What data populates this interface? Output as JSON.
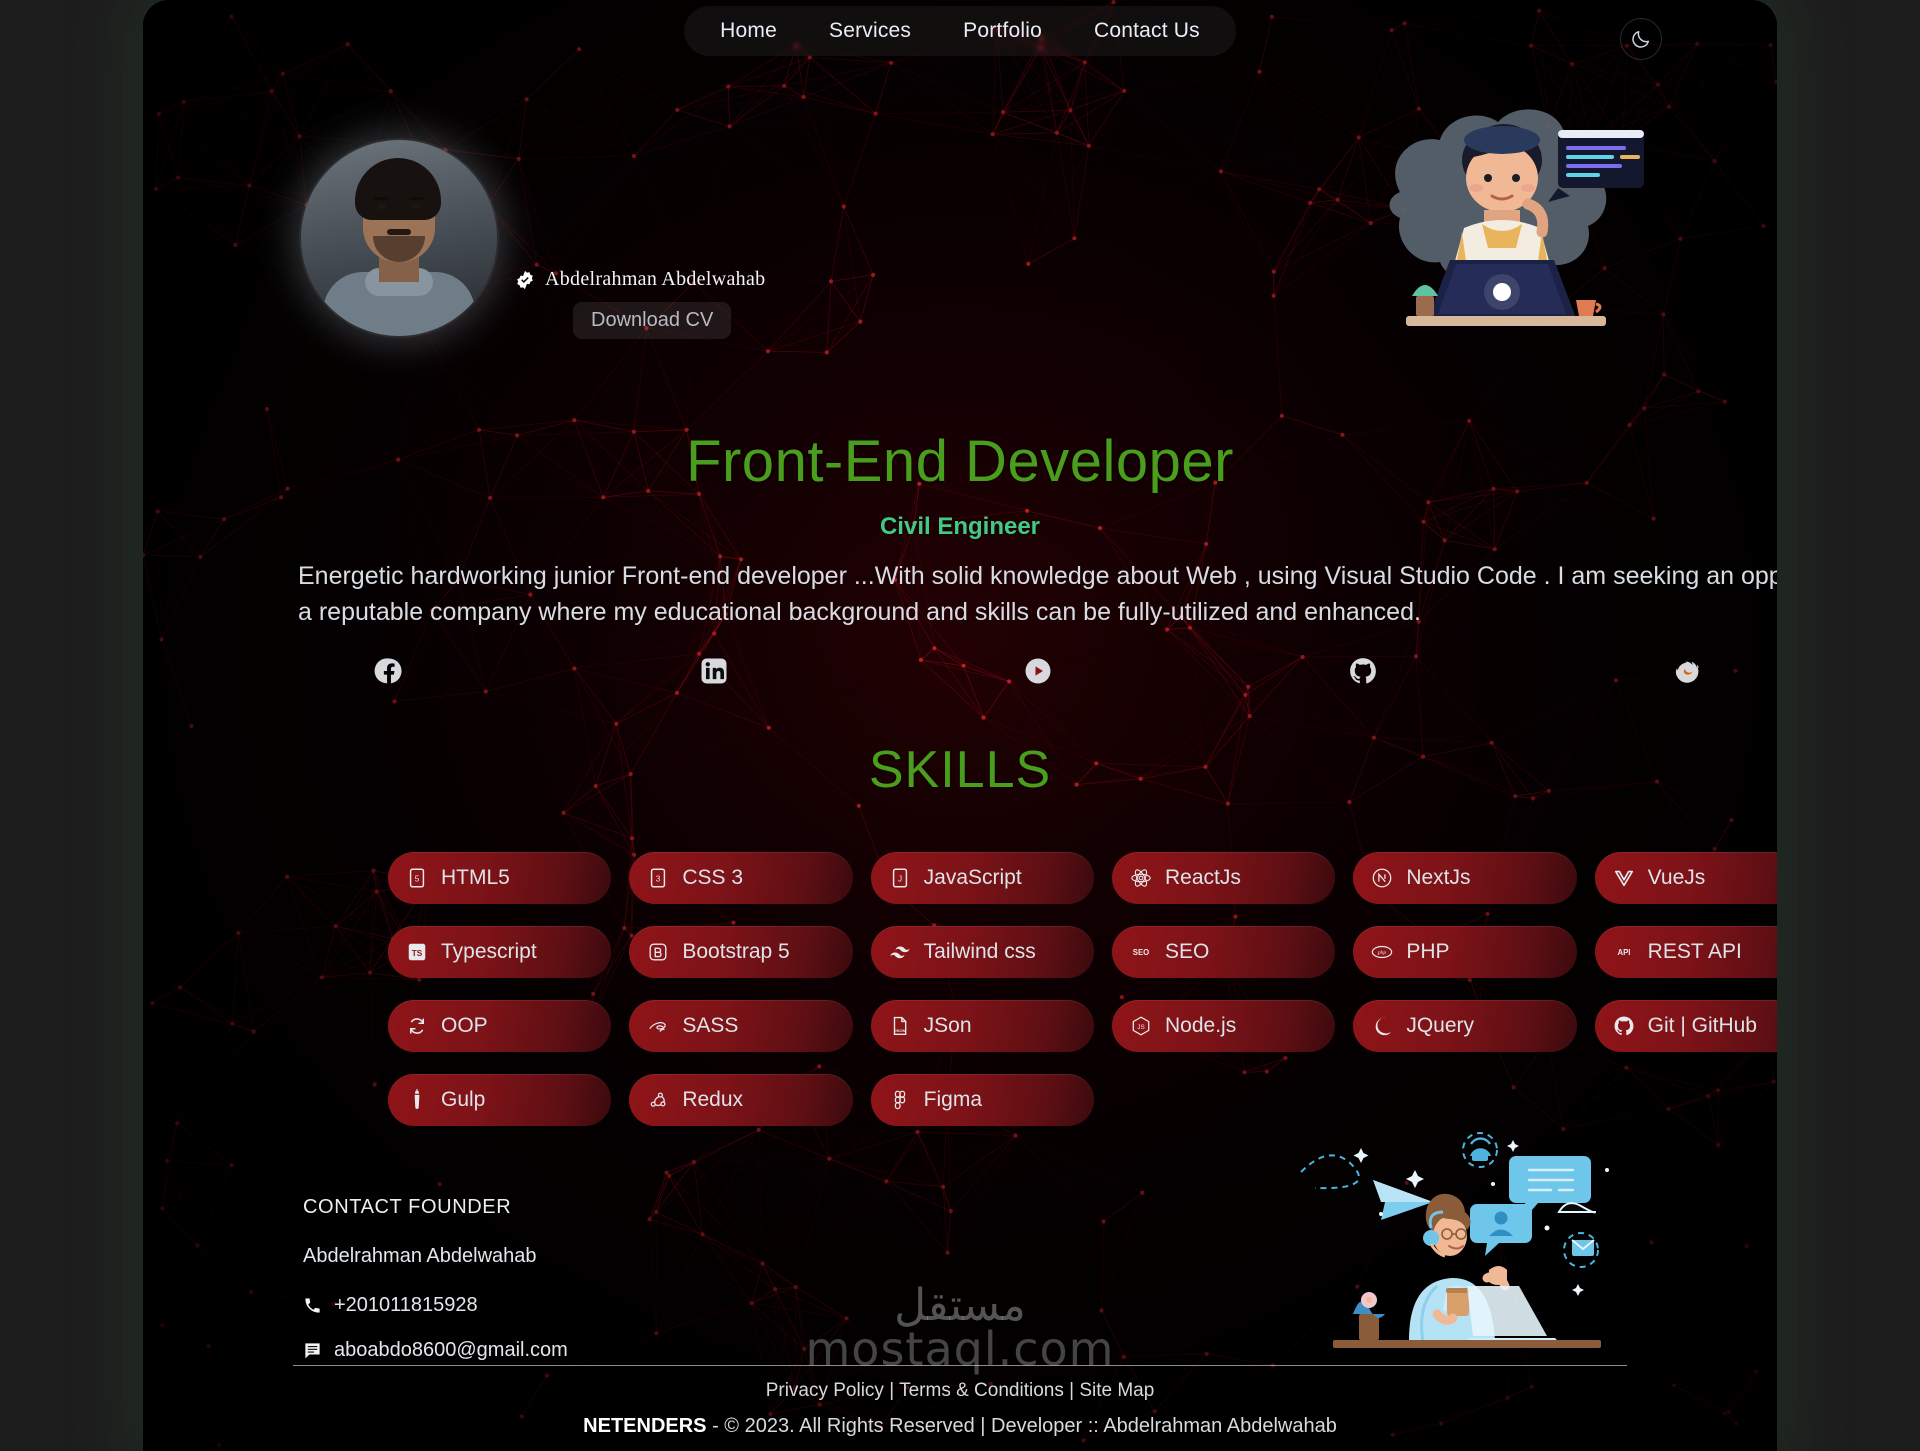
{
  "nav": {
    "items": [
      {
        "label": "Home"
      },
      {
        "label": "Services"
      },
      {
        "label": "Portfolio"
      },
      {
        "label": "Contact Us"
      }
    ],
    "theme_toggle_icon": "moon-icon"
  },
  "hero": {
    "avatar_alt": "profile-photo",
    "verified_icon": "verified-badge-icon",
    "name": "Abdelrahman  Abdelwahab",
    "download_cv_label": "Download CV",
    "headline": "Front-End Developer",
    "subheadline": "Civil Engineer",
    "about": "Energetic hardworking junior Front-end developer ...With solid knowledge about Web , using Visual Studio Code . I am seeking an opportunity in a reputable company where my educational background and skills can be fully-utilized and enhanced.",
    "illustration_top": "developer-at-laptop-illustration",
    "illustration_bottom": "support-agent-chat-illustration"
  },
  "socials": [
    {
      "name": "facebook-icon",
      "label": "Facebook"
    },
    {
      "name": "linkedin-icon",
      "label": "LinkedIn"
    },
    {
      "name": "youtube-icon",
      "label": "YouTube"
    },
    {
      "name": "github-icon",
      "label": "GitHub"
    },
    {
      "name": "firefox-icon",
      "label": "Firefox"
    }
  ],
  "skills": {
    "title": "SKILLS",
    "items": [
      {
        "label": "HTML5",
        "icon": "html5-icon"
      },
      {
        "label": "CSS 3",
        "icon": "css3-icon"
      },
      {
        "label": "JavaScript",
        "icon": "javascript-icon"
      },
      {
        "label": "ReactJs",
        "icon": "react-icon"
      },
      {
        "label": "NextJs",
        "icon": "nextjs-icon"
      },
      {
        "label": "Typescript",
        "icon": "typescript-icon"
      },
      {
        "label": "Bootstrap 5",
        "icon": "bootstrap-icon"
      },
      {
        "label": "Tailwind css",
        "icon": "tailwind-icon"
      },
      {
        "label": "SEO",
        "icon": "seo-icon"
      },
      {
        "label": "PHP",
        "icon": "php-icon"
      },
      {
        "label": "REST API",
        "icon": "api-icon"
      },
      {
        "label": "OOP",
        "icon": "oop-icon"
      },
      {
        "label": "SASS",
        "icon": "sass-icon"
      },
      {
        "label": "JSon",
        "icon": "json-icon"
      },
      {
        "label": "Node.js",
        "icon": "nodejs-icon"
      },
      {
        "label": "JQuery",
        "icon": "jquery-icon"
      },
      {
        "label": "Git | GitHub",
        "icon": "github-icon"
      },
      {
        "label": "Gulp",
        "icon": "gulp-icon"
      },
      {
        "label": "Redux",
        "icon": "redux-icon"
      },
      {
        "label": "Figma",
        "icon": "figma-icon"
      }
    ],
    "row1": [
      {
        "label": "HTML5",
        "icon": "html5-icon"
      },
      {
        "label": "CSS 3",
        "icon": "css3-icon"
      },
      {
        "label": "JavaScript",
        "icon": "javascript-icon"
      },
      {
        "label": "ReactJs",
        "icon": "react-icon"
      },
      {
        "label": "NextJs",
        "icon": "nextjs-icon"
      },
      {
        "label": "VueJs",
        "icon": "vue-icon"
      },
      {
        "label": "Typescript",
        "icon": "typescript-icon"
      }
    ]
  },
  "skills_grid": [
    {
      "label": "HTML5",
      "icon": "html5-icon"
    },
    {
      "label": "CSS 3",
      "icon": "css3-icon"
    },
    {
      "label": "JavaScript",
      "icon": "javascript-icon"
    },
    {
      "label": "ReactJs",
      "icon": "react-icon"
    },
    {
      "label": "NextJs",
      "icon": "nextjs-icon"
    },
    {
      "label": "VueJs",
      "icon": "vue-icon"
    },
    {
      "label": "Typescript",
      "icon": "typescript-icon"
    },
    {
      "label": "Bootstrap 5",
      "icon": "bootstrap-icon"
    },
    {
      "label": "Tailwind css",
      "icon": "tailwind-icon"
    },
    {
      "label": "SEO",
      "icon": "seo-icon"
    },
    {
      "label": "PHP",
      "icon": "php-icon"
    },
    {
      "label": "REST API",
      "icon": "api-icon"
    },
    {
      "label": "OOP",
      "icon": "oop-icon"
    },
    {
      "label": "SASS",
      "icon": "sass-icon"
    },
    {
      "label": "JSon",
      "icon": "json-icon"
    },
    {
      "label": "Node.js",
      "icon": "nodejs-icon"
    },
    {
      "label": "JQuery",
      "icon": "jquery-icon"
    },
    {
      "label": "Git | GitHub",
      "icon": "github-icon"
    },
    {
      "label": "Gulp",
      "icon": "gulp-icon"
    },
    {
      "label": "Redux",
      "icon": "redux-icon"
    },
    {
      "label": "Figma",
      "icon": "figma-icon"
    }
  ],
  "contact": {
    "title": "CONTACT FOUNDER",
    "person": "Abdelrahman Abdelwahab",
    "phone": "+201011815928",
    "phone_icon": "phone-icon",
    "email": "aboabdo8600@gmail.com",
    "email_icon": "message-icon"
  },
  "footer": {
    "links": [
      {
        "label": "Privacy Policy"
      },
      {
        "label": "Terms & Conditions"
      },
      {
        "label": "Site Map"
      }
    ],
    "separator": " | ",
    "brand": "NETENDERS",
    "copyright": " - © 2023. All Rights Reserved | Developer :: Abdelrahman Abdelwahab"
  },
  "watermark": {
    "arabic": "مستقل",
    "latin": "mostaql.com"
  },
  "colors": {
    "accent_green": "#4a9e1e",
    "sub_green": "#3fcb85",
    "chip_red": "#8f1418",
    "page_bg": "#050203",
    "text": "#d8dde3"
  }
}
